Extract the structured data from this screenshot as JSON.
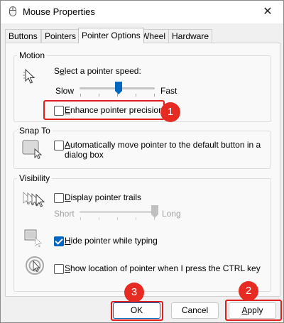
{
  "window": {
    "title": "Mouse Properties",
    "close_glyph": "✕"
  },
  "tabs": [
    {
      "label": "Buttons"
    },
    {
      "label": "Pointers"
    },
    {
      "label": "Pointer Options",
      "active": true
    },
    {
      "label": "Wheel"
    },
    {
      "label": "Hardware"
    }
  ],
  "motion": {
    "title": "Motion",
    "speed_label_pre": "S",
    "speed_label_mid": "e",
    "speed_label_post": "lect a pointer speed:",
    "slow": "Slow",
    "fast": "Fast",
    "speed_value": 0.52,
    "enhance_pre": "",
    "enhance_key": "E",
    "enhance_post": "nhance pointer precision",
    "enhance_checked": false
  },
  "snap": {
    "title": "Snap To",
    "auto_pre": "",
    "auto_key": "A",
    "auto_line1": "utomatically move pointer to the default button in a",
    "auto_line2": "dialog box",
    "auto_checked": false
  },
  "visibility": {
    "title": "Visibility",
    "trails_pre": "",
    "trails_key": "D",
    "trails_post": "isplay pointer trails",
    "trails_checked": false,
    "short": "Short",
    "long": "Long",
    "trails_value": 1.0,
    "hide_pre": "",
    "hide_key": "H",
    "hide_post": "ide pointer while typing",
    "hide_checked": true,
    "show_pre": "",
    "show_key": "S",
    "show_post": "how location of pointer when I press the CTRL key",
    "show_checked": false
  },
  "buttons": {
    "ok": "OK",
    "cancel": "Cancel",
    "apply_pre": "",
    "apply_key": "A",
    "apply_post": "pply"
  },
  "annotations": {
    "badge1": "1",
    "badge2": "2",
    "badge3": "3",
    "color": "#e52b22"
  },
  "icons": [
    "mouse-icon",
    "close-icon",
    "pointer-speed-icon",
    "snap-to-icon",
    "pointer-trails-icon",
    "hide-pointer-icon",
    "show-location-icon"
  ]
}
